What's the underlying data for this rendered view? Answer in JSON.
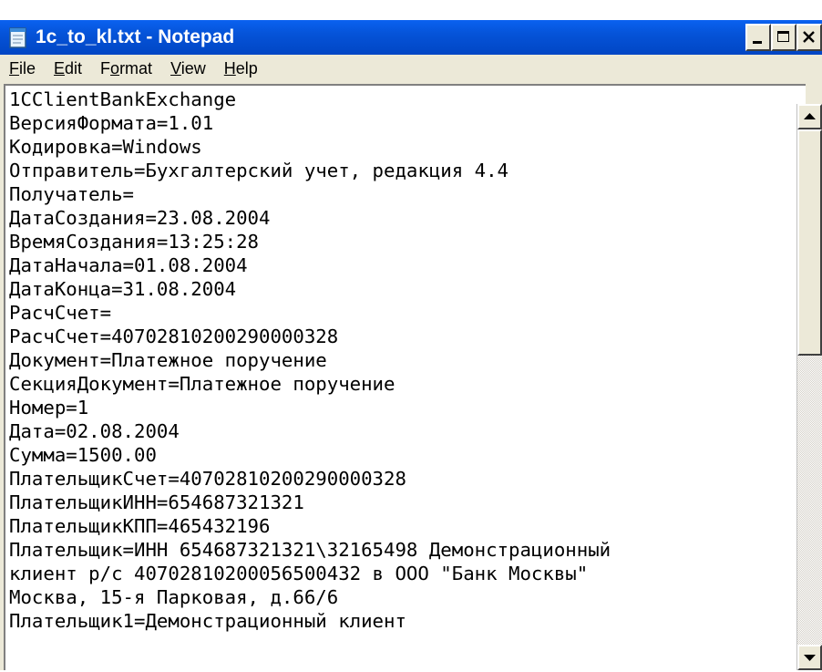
{
  "window": {
    "title": "1c_to_kl.txt - Notepad",
    "buttons": [
      "minimize",
      "maximize",
      "close"
    ]
  },
  "menu": {
    "items": [
      {
        "label": "File",
        "mnemonic": "F"
      },
      {
        "label": "Edit",
        "mnemonic": "E"
      },
      {
        "label": "Format",
        "mnemonic": "o"
      },
      {
        "label": "View",
        "mnemonic": "V"
      },
      {
        "label": "Help",
        "mnemonic": "H"
      }
    ]
  },
  "editor": {
    "lines": [
      "1CClientBankExchange",
      "ВерсияФормата=1.01",
      "Кодировка=Windows",
      "Отправитель=Бухгалтерский учет, редакция 4.4",
      "Получатель=",
      "ДатаСоздания=23.08.2004",
      "ВремяСоздания=13:25:28",
      "ДатаНачала=01.08.2004",
      "ДатаКонца=31.08.2004",
      "РасчСчет=",
      "РасчСчет=40702810200290000328",
      "Документ=Платежное поручение",
      "СекцияДокумент=Платежное поручение",
      "Номер=1",
      "Дата=02.08.2004",
      "Сумма=1500.00",
      "ПлательщикСчет=40702810200290000328",
      "ПлательщикИНН=654687321321",
      "ПлательщикКПП=465432196",
      "Плательщик=ИНН 654687321321\\32165498 Демонстрационный",
      "клиент р/с 40702810200056500432 в ООО \"Банк Москвы\"",
      "Москва, 15-я Парковая, д.66/6",
      "Плательщик1=Демонстрационный клиент"
    ]
  },
  "colors": {
    "titlebar": "#0553d8",
    "chrome": "#ece9d8"
  },
  "icons": {
    "app": "notepad-icon",
    "minimize": "minimize-icon",
    "maximize": "maximize-icon",
    "close": "close-icon",
    "scroll_up": "arrow-up-icon",
    "scroll_down": "arrow-down-icon"
  }
}
